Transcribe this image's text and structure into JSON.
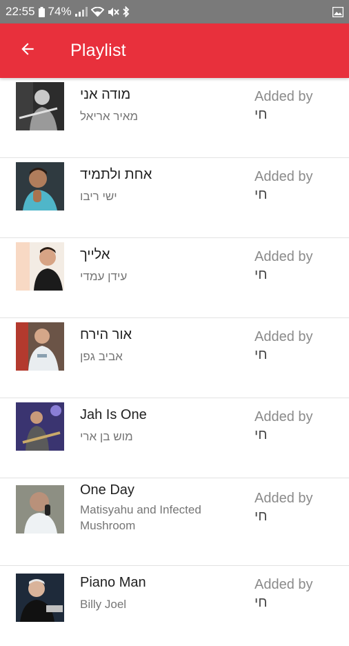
{
  "status_bar": {
    "time": "22:55",
    "battery": "74%",
    "icons": [
      "battery-icon",
      "signal-icon",
      "wifi-icon",
      "mute-icon",
      "bluetooth-icon",
      "image-icon"
    ]
  },
  "app_bar": {
    "title": "Playlist",
    "back_icon": "arrow-back-icon",
    "color": "#e8303c"
  },
  "playlist": [
    {
      "title": "מודה אני",
      "artist": "מאיר אריאל",
      "added_label": "Added by",
      "added_by": "חי"
    },
    {
      "title": "אחת ולתמיד",
      "artist": "ישי ריבו",
      "added_label": "Added by",
      "added_by": "חי"
    },
    {
      "title": "אלייך",
      "artist": "עידן עמדי",
      "added_label": "Added by",
      "added_by": "חי"
    },
    {
      "title": "אור הירח",
      "artist": "אביב גפן",
      "added_label": "Added by",
      "added_by": "חי"
    },
    {
      "title": "Jah Is One",
      "artist": "מוש בן ארי",
      "added_label": "Added by",
      "added_by": "חי"
    },
    {
      "title": "One Day",
      "artist": "Matisyahu and Infected Mushroom",
      "added_label": "Added by",
      "added_by": "חי"
    },
    {
      "title": "Piano Man",
      "artist": "Billy Joel",
      "added_label": "Added by",
      "added_by": "חי"
    }
  ]
}
